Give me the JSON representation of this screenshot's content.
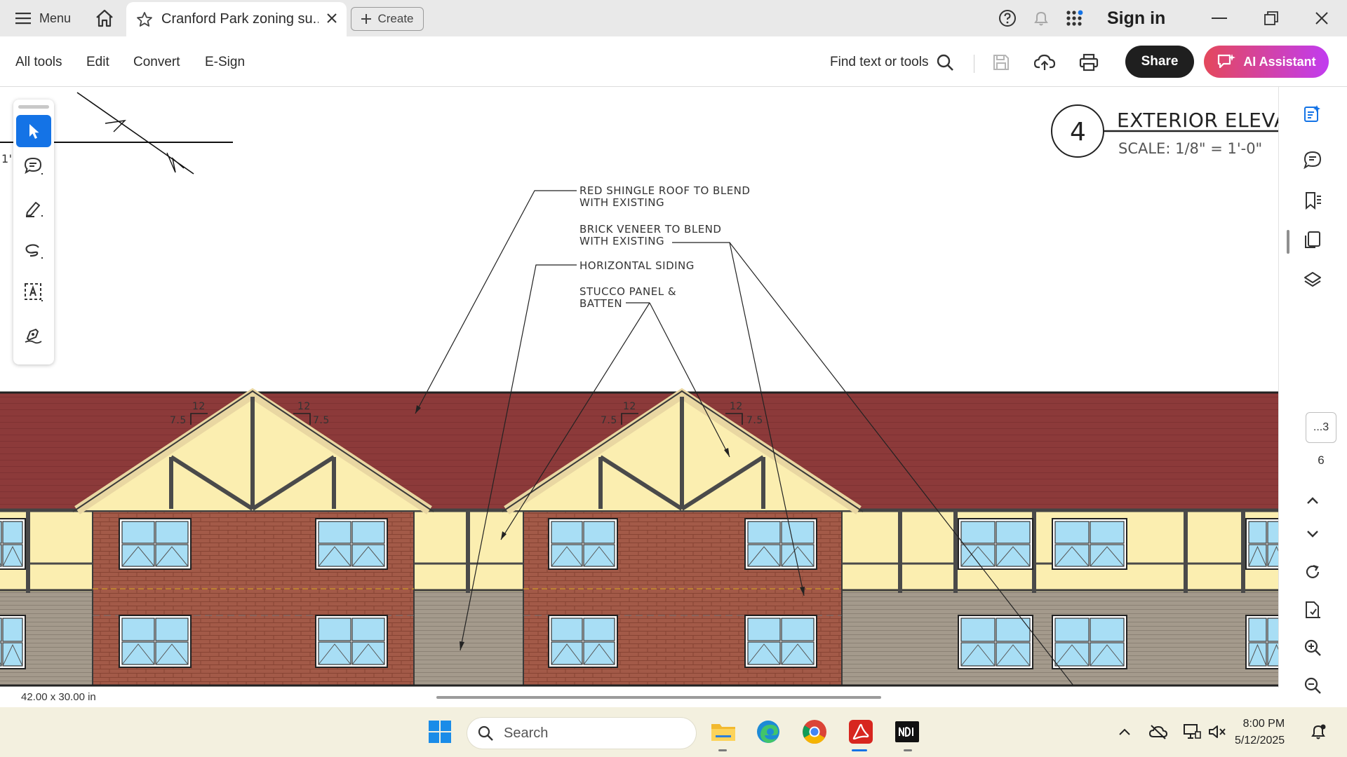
{
  "titlebar": {
    "menu_label": "Menu",
    "tab_title": "Cranford Park zoning su...",
    "create_label": "Create",
    "sign_in_label": "Sign in"
  },
  "toolbar": {
    "menu_items": [
      "All tools",
      "Edit",
      "Convert",
      "E-Sign"
    ],
    "find_label": "Find text or tools",
    "share_label": "Share",
    "ai_label": "AI Assistant"
  },
  "drawing": {
    "title": "EXTERIOR ELEVATIO",
    "scale": "SCALE:   1/8\" = 1'-0\"",
    "detail_number": "4",
    "edge_label": "1'",
    "notes": [
      "RED SHINGLE ROOF TO BLEND",
      "WITH EXISTING",
      "BRICK VENEER TO BLEND",
      "WITH EXISTING",
      "HORIZONTAL SIDING",
      "STUCCO PANEL &",
      "BATTEN"
    ],
    "pitch_labels": [
      "12",
      "7.5"
    ]
  },
  "page_nav": {
    "current": "...3",
    "total": "6"
  },
  "status": {
    "page_size": "42.00 x 30.00 in"
  },
  "taskbar": {
    "search_placeholder": "Search",
    "time": "8:00 PM",
    "date": "5/12/2025"
  },
  "colors": {
    "roof": "#8c3a3a",
    "brick": "#a35a48",
    "stucco": "#fbeeb0",
    "siding": "#a49a8c",
    "window_glass": "#a8def5",
    "accent": "#1473e6"
  }
}
